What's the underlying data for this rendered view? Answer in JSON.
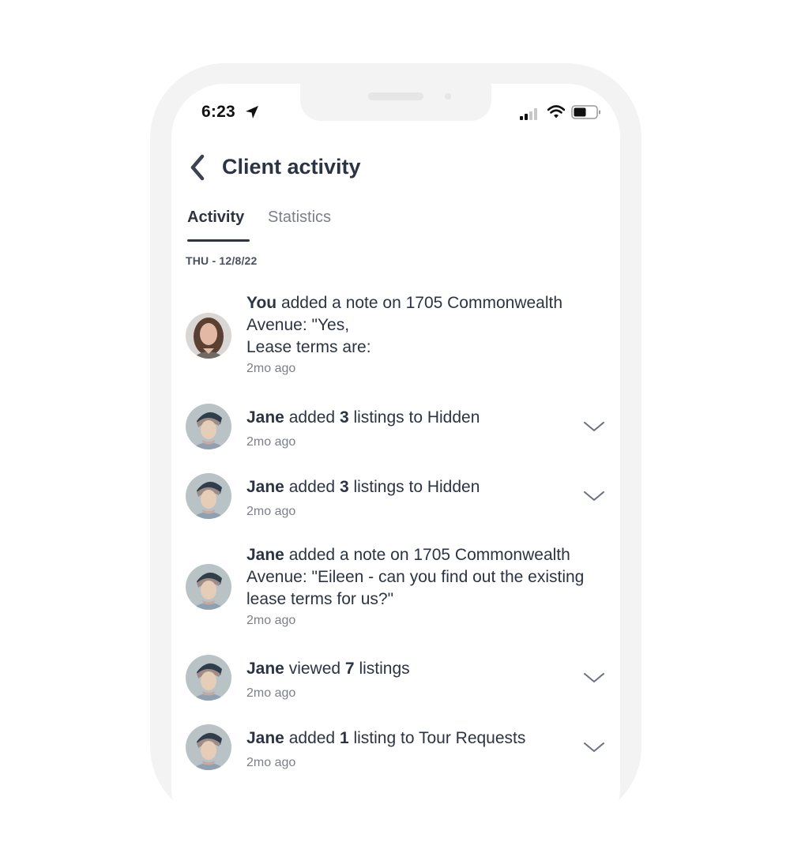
{
  "status_bar": {
    "time": "6:23",
    "icons": [
      "location-arrow-icon",
      "cellular-signal-icon",
      "wifi-icon",
      "battery-icon"
    ]
  },
  "header": {
    "back_icon": "chevron-left-icon",
    "title": "Client activity"
  },
  "tabs": [
    {
      "label": "Activity",
      "active": true
    },
    {
      "label": "Statistics",
      "active": false
    }
  ],
  "date_header": "THU - 12/8/22",
  "feed": [
    {
      "actor": "You",
      "segments": [
        {
          "text": "You",
          "bold": true
        },
        {
          "text": " added a note on 1705 Commonwealth Avenue: \"Yes,",
          "bold": false
        },
        {
          "text": "\nLease terms are:",
          "bold": false
        }
      ],
      "time_ago": "2mo ago",
      "avatar": "user-avatar-you",
      "expandable": false
    },
    {
      "actor": "Jane",
      "segments": [
        {
          "text": "Jane",
          "bold": true
        },
        {
          "text": " added ",
          "bold": false
        },
        {
          "text": "3",
          "bold": true
        },
        {
          "text": " listings to Hidden",
          "bold": false
        }
      ],
      "time_ago": "2mo ago",
      "avatar": "user-avatar-jane",
      "expandable": true
    },
    {
      "actor": "Jane",
      "segments": [
        {
          "text": "Jane",
          "bold": true
        },
        {
          "text": " added ",
          "bold": false
        },
        {
          "text": "3",
          "bold": true
        },
        {
          "text": " listings to Hidden",
          "bold": false
        }
      ],
      "time_ago": "2mo ago",
      "avatar": "user-avatar-jane",
      "expandable": true
    },
    {
      "actor": "Jane",
      "segments": [
        {
          "text": "Jane",
          "bold": true
        },
        {
          "text": " added a note on 1705 Commonwealth Avenue: \"Eileen - can you find out the existing lease terms for us?\"",
          "bold": false
        }
      ],
      "time_ago": "2mo ago",
      "avatar": "user-avatar-jane",
      "expandable": false
    },
    {
      "actor": "Jane",
      "segments": [
        {
          "text": "Jane",
          "bold": true
        },
        {
          "text": " viewed ",
          "bold": false
        },
        {
          "text": "7",
          "bold": true
        },
        {
          "text": " listings",
          "bold": false
        }
      ],
      "time_ago": "2mo ago",
      "avatar": "user-avatar-jane",
      "expandable": true
    },
    {
      "actor": "Jane",
      "segments": [
        {
          "text": "Jane",
          "bold": true
        },
        {
          "text": " added ",
          "bold": false
        },
        {
          "text": "1",
          "bold": true
        },
        {
          "text": " listing to Tour Requests",
          "bold": false
        }
      ],
      "time_ago": "2mo ago",
      "avatar": "user-avatar-jane",
      "expandable": true
    }
  ],
  "colors": {
    "text_primary": "#2c3444",
    "text_secondary": "#7b7f88",
    "bezel": "#f3f3f4"
  }
}
